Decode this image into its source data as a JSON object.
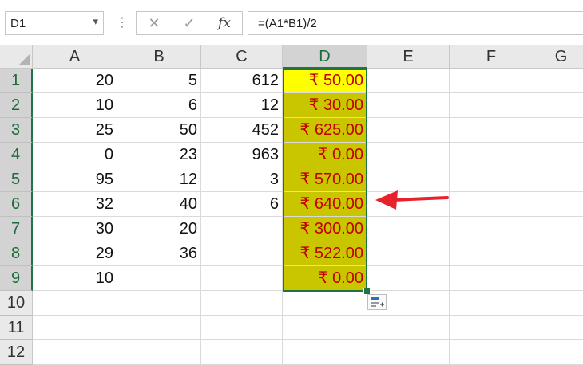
{
  "formula_bar": {
    "name_box": "D1",
    "name_box_arrow": "▾",
    "dots": "⋮",
    "cancel_icon": "✕",
    "enter_icon": "✓",
    "fx_label": "fx",
    "formula": "=(A1*B1)/2"
  },
  "columns": [
    "A",
    "B",
    "C",
    "D",
    "E",
    "F",
    "G"
  ],
  "rows": [
    "1",
    "2",
    "3",
    "4",
    "5",
    "6",
    "7",
    "8",
    "9",
    "10",
    "11",
    "12"
  ],
  "cells": {
    "A": [
      "20",
      "10",
      "25",
      "0",
      "95",
      "32",
      "30",
      "29",
      "10",
      "",
      "",
      ""
    ],
    "B": [
      "5",
      "6",
      "50",
      "23",
      "12",
      "40",
      "20",
      "36",
      "",
      "",
      "",
      ""
    ],
    "C": [
      "612",
      "12",
      "452",
      "963",
      "3",
      "6",
      "",
      "",
      "",
      "",
      "",
      ""
    ],
    "D": [
      "₹ 50.00",
      "₹ 30.00",
      "₹ 625.00",
      "₹ 0.00",
      "₹ 570.00",
      "₹ 640.00",
      "₹ 300.00",
      "₹ 522.00",
      "₹ 0.00",
      "",
      "",
      ""
    ]
  },
  "selection": {
    "active_cell": "D1",
    "range_column": "D",
    "rows_selected": 9
  },
  "colors": {
    "selection_fill": "#c9c600",
    "active_fill": "#ffff00",
    "currency_text": "#c00000",
    "selection_border": "#217346",
    "arrow": "#e8212a"
  },
  "icons": {
    "arrow_annotation": "red-left-arrow-icon",
    "paste_options": "paste-options-icon"
  }
}
